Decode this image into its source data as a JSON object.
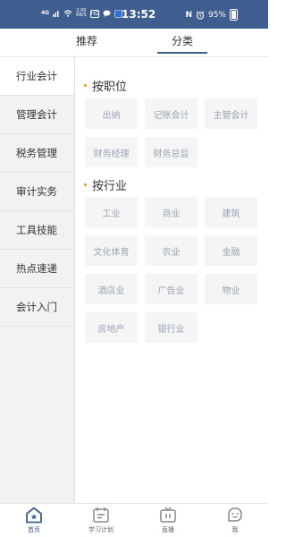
{
  "status_bar": {
    "signal": "4G",
    "speed_value": "2.00",
    "speed_unit": "KB/S",
    "badge_hd": "HD",
    "time": "13:52",
    "nfc": "N",
    "battery": "95%"
  },
  "tabs": {
    "recommend": "推荐",
    "category": "分类",
    "active": "category"
  },
  "sidebar": {
    "items": [
      {
        "label": "行业会计",
        "active": true
      },
      {
        "label": "管理会计",
        "active": false
      },
      {
        "label": "税务管理",
        "active": false
      },
      {
        "label": "审计实务",
        "active": false
      },
      {
        "label": "工具技能",
        "active": false
      },
      {
        "label": "热点速递",
        "active": false
      },
      {
        "label": "会计入门",
        "active": false
      }
    ]
  },
  "sections": {
    "by_position": {
      "title": "按职位",
      "items": [
        "出纳",
        "记账会计",
        "主管会计",
        "财务经理",
        "财务总监"
      ]
    },
    "by_industry": {
      "title": "按行业",
      "items": [
        "工业",
        "商业",
        "建筑",
        "文化体育",
        "农业",
        "金融",
        "酒店业",
        "广告业",
        "物业",
        "房地产",
        "银行业"
      ]
    }
  },
  "bottom_nav": {
    "items": [
      {
        "label": "首页",
        "icon": "home-icon",
        "active": true
      },
      {
        "label": "学习计划",
        "icon": "calendar-icon",
        "active": false
      },
      {
        "label": "直播",
        "icon": "tv-icon",
        "active": false
      },
      {
        "label": "我",
        "icon": "smiley-icon",
        "active": false
      }
    ]
  },
  "colors": {
    "brand": "#3f5d8f",
    "accent_dot": "#f0a020",
    "chip_bg": "#f5f5f5",
    "chip_text": "#9aa4b4"
  }
}
